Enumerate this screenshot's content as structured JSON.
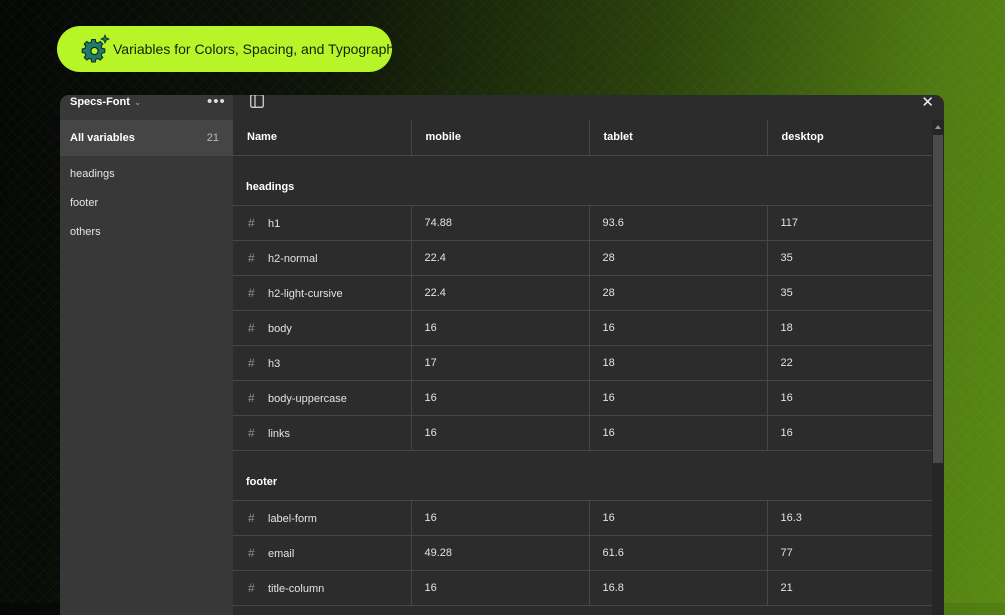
{
  "banner": {
    "text": "Variables for Colors, Spacing, and Typography",
    "icon": "gear-sparkle-icon"
  },
  "sidebar": {
    "collection_name": "Specs-Font",
    "all_variables": {
      "label": "All variables",
      "count": "21"
    },
    "groups": [
      "headings",
      "footer",
      "others"
    ]
  },
  "table": {
    "columns": [
      "Name",
      "mobile",
      "tablet",
      "desktop"
    ],
    "groups": [
      {
        "name": "headings",
        "rows": [
          {
            "name": "h1",
            "values": [
              "74.88",
              "93.6",
              "117"
            ]
          },
          {
            "name": "h2-normal",
            "values": [
              "22.4",
              "28",
              "35"
            ]
          },
          {
            "name": "h2-light-cursive",
            "values": [
              "22.4",
              "28",
              "35"
            ]
          },
          {
            "name": "body",
            "values": [
              "16",
              "16",
              "18"
            ]
          },
          {
            "name": "h3",
            "values": [
              "17",
              "18",
              "22"
            ]
          },
          {
            "name": "body-uppercase",
            "values": [
              "16",
              "16",
              "16"
            ]
          },
          {
            "name": "links",
            "values": [
              "16",
              "16",
              "16"
            ]
          }
        ]
      },
      {
        "name": "footer",
        "rows": [
          {
            "name": "label-form",
            "values": [
              "16",
              "16",
              "16.3"
            ]
          },
          {
            "name": "email",
            "values": [
              "49.28",
              "61.6",
              "77"
            ]
          },
          {
            "name": "title-column",
            "values": [
              "16",
              "16.8",
              "21"
            ]
          }
        ]
      }
    ]
  },
  "colors": {
    "accent": "#b8f528",
    "panel": "#2c2c2c",
    "sidebar": "#383838"
  }
}
